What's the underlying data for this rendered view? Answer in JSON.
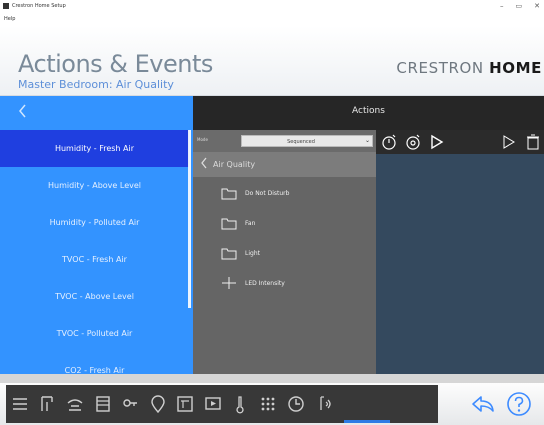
{
  "window": {
    "title": "Crestron Home Setup",
    "menu": "Help",
    "controls": [
      "–",
      "▭",
      "✕"
    ]
  },
  "header": {
    "title": "Actions & Events",
    "subtitle": "Master Bedroom: Air Quality",
    "brand_light": "CRESTRON ",
    "brand_bold": "HOME"
  },
  "topbar": {
    "back_icon": "chevron-left-icon",
    "title": "Actions"
  },
  "sidebar": {
    "items": [
      {
        "label": "Humidity - Fresh Air",
        "selected": true
      },
      {
        "label": "Humidity - Above Level",
        "selected": false
      },
      {
        "label": "Humidity - Polluted Air",
        "selected": false
      },
      {
        "label": "TVOC - Fresh Air",
        "selected": false
      },
      {
        "label": "TVOC - Above Level",
        "selected": false
      },
      {
        "label": "TVOC - Polluted Air",
        "selected": false
      },
      {
        "label": "CO2 - Fresh Air",
        "selected": false
      }
    ]
  },
  "panel": {
    "mode_label": "Mode",
    "mode_value": "Sequenced",
    "breadcrumb": "Air Quality",
    "items": [
      {
        "label": "Do Not Disturb",
        "icon": "folder-icon"
      },
      {
        "label": "Fan",
        "icon": "folder-icon"
      },
      {
        "label": "Light",
        "icon": "folder-icon"
      },
      {
        "label": "LED Intensity",
        "icon": "plus-icon"
      }
    ]
  },
  "workspace_toolbar": {
    "icons": [
      "add-delay-icon",
      "settings-delay-icon",
      "play-icon",
      "play-outline-icon",
      "delete-icon"
    ]
  },
  "taskbar": {
    "icons": [
      "menu-icon",
      "rooms-icon",
      "scene-icon",
      "shades-icon",
      "keys-icon",
      "location-icon",
      "thermostat-panel-icon",
      "media-icon",
      "temperature-icon",
      "keypad-icon",
      "clock-icon",
      "sensor-icon"
    ],
    "undo_icon": "undo-icon",
    "help_icon": "help-icon",
    "accent": "#2d7be5"
  },
  "colors": {
    "sidebar": "#3393ff",
    "selected": "#1f3fe0",
    "panel": "#656565",
    "workspace": "#34495e"
  }
}
